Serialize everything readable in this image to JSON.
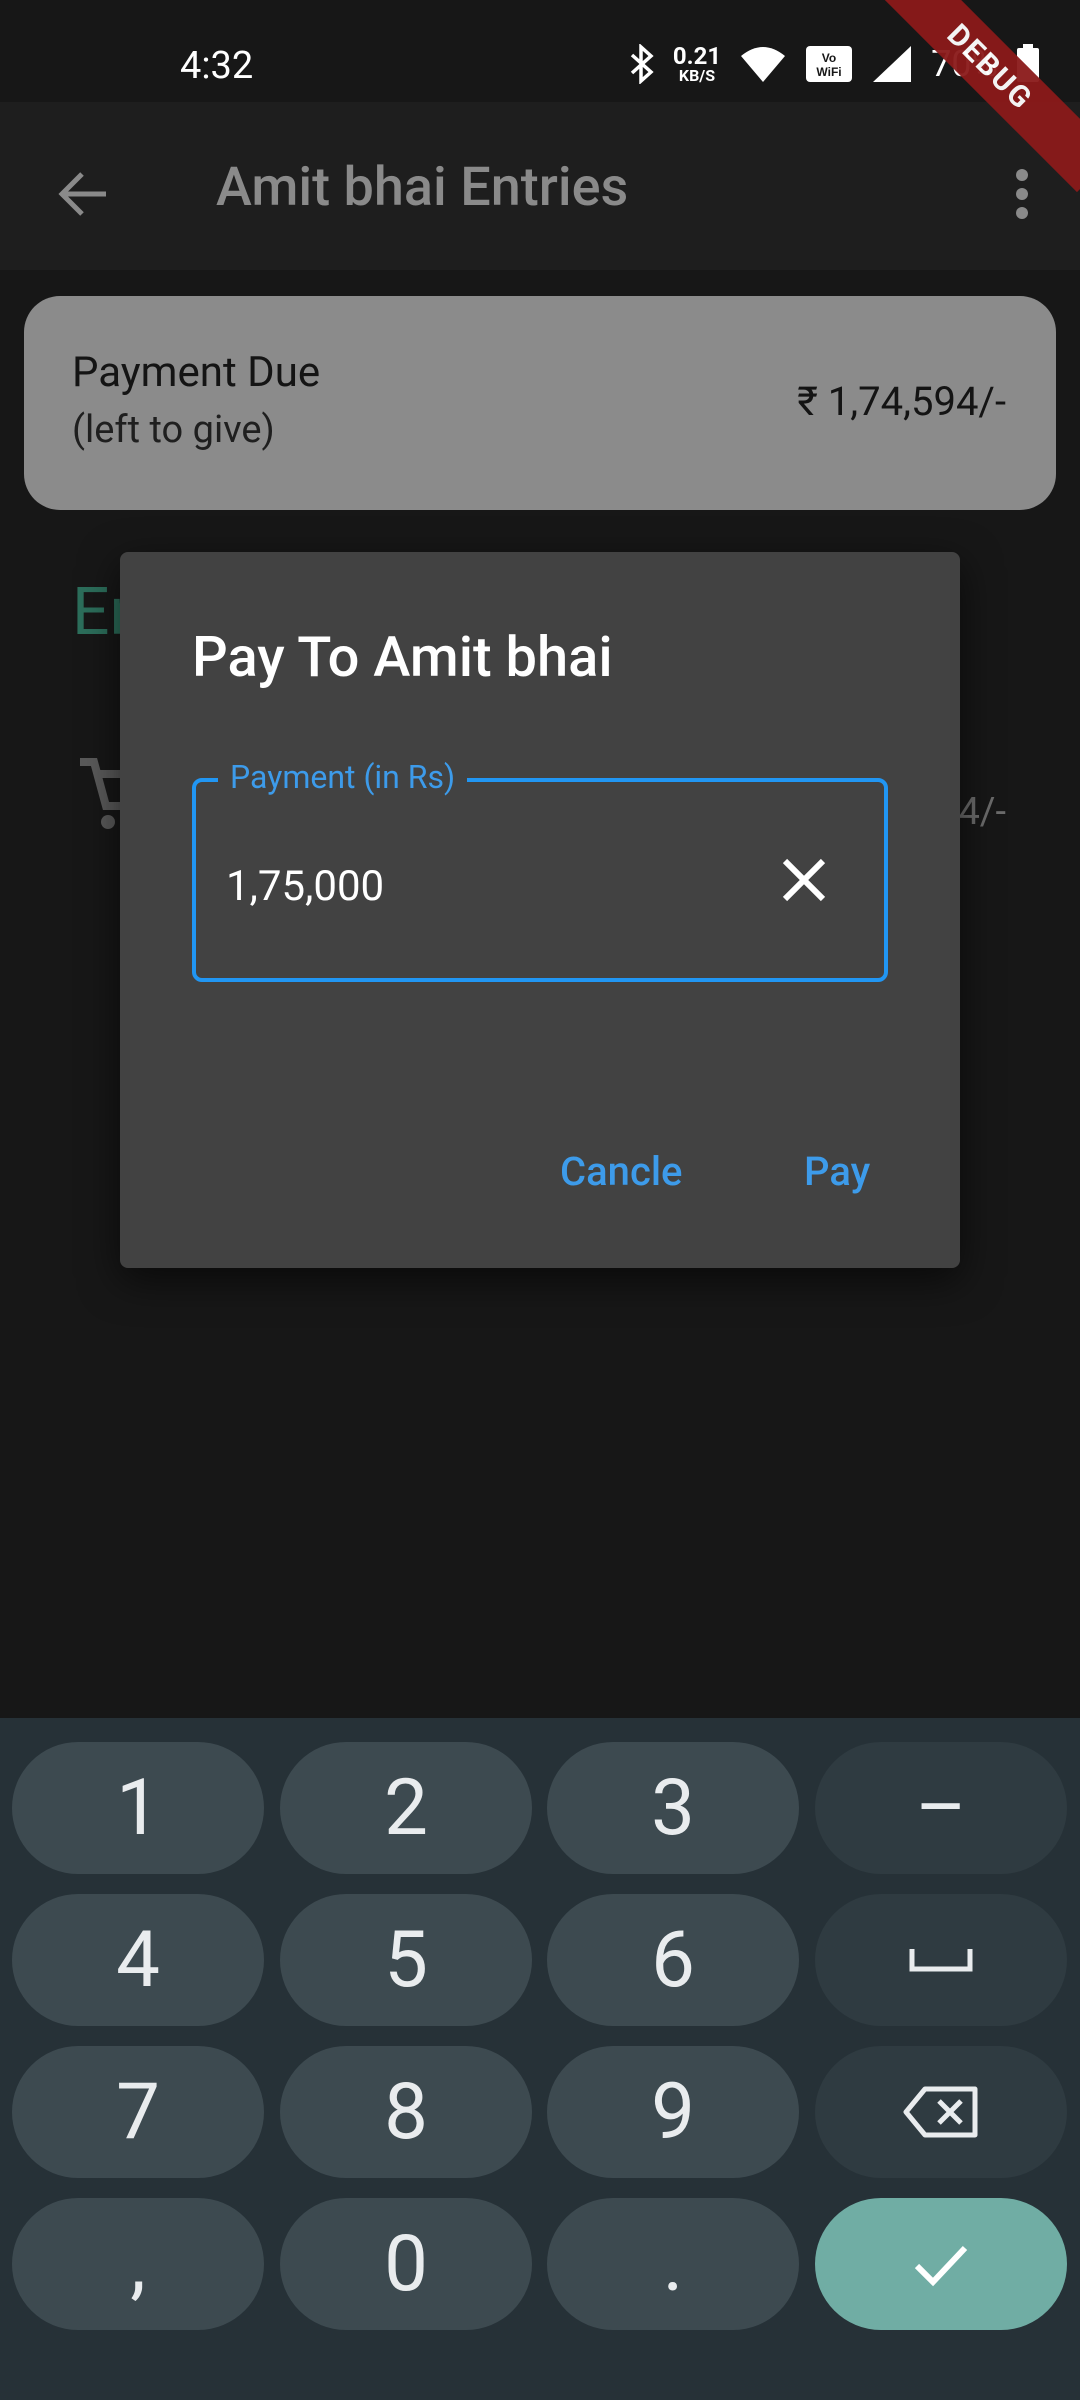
{
  "status_bar": {
    "time": "4:32",
    "speed_value": "0.21",
    "speed_unit": "KB/S",
    "volte": "Vo\nWiFi",
    "battery": "70%"
  },
  "debug_banner": "DEBUG",
  "app_bar": {
    "title": "Amit bhai Entries"
  },
  "due_card": {
    "label": "Payment Due",
    "sub_label": "(left to give)",
    "amount": "₹ 1,74,594/-"
  },
  "entries": {
    "heading": "En",
    "row_amount": "4/-"
  },
  "dialog": {
    "title": "Pay To Amit bhai",
    "field_label": "Payment (in Rs)",
    "field_value": "1,75,000",
    "cancel_label": "Cancle",
    "pay_label": "Pay"
  },
  "keyboard": {
    "keys": [
      "1",
      "2",
      "3",
      "–",
      "4",
      "5",
      "6",
      "␣",
      "7",
      "8",
      "9",
      "⌫",
      ",",
      "0",
      ".",
      "✓"
    ]
  },
  "colors": {
    "accent": "#2196f3",
    "card": "#8b8b8b",
    "dialog": "#424242",
    "keyboard": "#263137",
    "enter_key": "#70ada4"
  }
}
